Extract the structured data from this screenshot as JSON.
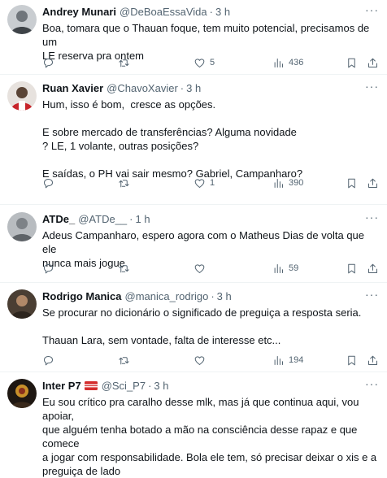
{
  "tweets": [
    {
      "name": "Andrey Munari",
      "handle": "@DeBoaEssaVida",
      "separator": "·",
      "time": "3 h",
      "text": "Boa, tomara que o Thauan foque, tem muito potencial, precisamos de um\nLE reserva pra ontem",
      "replies": "",
      "retweets": "",
      "likes": "5",
      "views": "436",
      "avatar_color": "#8a8f94"
    },
    {
      "name": "Ruan Xavier",
      "handle": "@ChavoXavier",
      "separator": "·",
      "time": "3 h",
      "text": "Hum, isso é bom,  cresce as opções.\n\nE sobre mercado de transferências? Alguma novidade\n? LE, 1 volante, outras posições?\n\nE saídas, o PH vai sair mesmo? Gabriel, Campanharo?",
      "replies": "",
      "retweets": "",
      "likes": "1",
      "views": "390",
      "avatar_color": "#c7252b"
    },
    {
      "name": "ATDe_",
      "handle": "@ATDe__",
      "separator": "·",
      "time": "1 h",
      "text": "Adeus Campanharo, espero agora com o Matheus Dias de volta que ele\nnunca mais jogue",
      "replies": "",
      "retweets": "",
      "likes": "",
      "views": "59",
      "avatar_color": "#9aa0a6"
    },
    {
      "name": "Rodrigo Manica",
      "handle": "@manica_rodrigo",
      "separator": "·",
      "time": "3 h",
      "text": "Se procurar no dicionário o significado de preguiça a resposta seria.\n\nThauan Lara, sem vontade, falta de interesse etc...",
      "replies": "",
      "retweets": "",
      "likes": "",
      "views": "194",
      "avatar_color": "#6b5a48"
    },
    {
      "name": "Inter P7",
      "handle": "@Sci_P7",
      "separator": "·",
      "time": "3 h",
      "text": "Eu sou crítico pra caralho desse mlk, mas já que continua aqui, vou apoiar,\nque alguém tenha botado a mão na consciência desse rapaz e que comece\na jogar com responsabilidade. Bola ele tem, só precisar deixar o xis e a\npreguiça de lado",
      "avatar_color": "#2a1f18"
    }
  ],
  "colors": {
    "text": "#0f1419",
    "secondary": "#536471",
    "divider": "#eff3f4",
    "flag_red": "#d42e2e"
  },
  "icons": [
    "reply-icon",
    "retweet-icon",
    "like-icon",
    "views-icon",
    "bookmark-icon",
    "share-icon",
    "more-icon",
    "flag-icon"
  ]
}
